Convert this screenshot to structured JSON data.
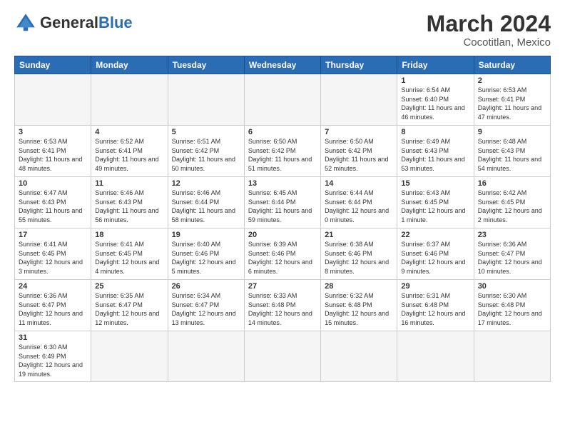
{
  "header": {
    "logo_general": "General",
    "logo_blue": "Blue",
    "month_title": "March 2024",
    "location": "Cocotitlan, Mexico"
  },
  "weekdays": [
    "Sunday",
    "Monday",
    "Tuesday",
    "Wednesday",
    "Thursday",
    "Friday",
    "Saturday"
  ],
  "weeks": [
    [
      {
        "day": "",
        "info": ""
      },
      {
        "day": "",
        "info": ""
      },
      {
        "day": "",
        "info": ""
      },
      {
        "day": "",
        "info": ""
      },
      {
        "day": "",
        "info": ""
      },
      {
        "day": "1",
        "info": "Sunrise: 6:54 AM\nSunset: 6:40 PM\nDaylight: 11 hours and 46 minutes."
      },
      {
        "day": "2",
        "info": "Sunrise: 6:53 AM\nSunset: 6:41 PM\nDaylight: 11 hours and 47 minutes."
      }
    ],
    [
      {
        "day": "3",
        "info": "Sunrise: 6:53 AM\nSunset: 6:41 PM\nDaylight: 11 hours and 48 minutes."
      },
      {
        "day": "4",
        "info": "Sunrise: 6:52 AM\nSunset: 6:41 PM\nDaylight: 11 hours and 49 minutes."
      },
      {
        "day": "5",
        "info": "Sunrise: 6:51 AM\nSunset: 6:42 PM\nDaylight: 11 hours and 50 minutes."
      },
      {
        "day": "6",
        "info": "Sunrise: 6:50 AM\nSunset: 6:42 PM\nDaylight: 11 hours and 51 minutes."
      },
      {
        "day": "7",
        "info": "Sunrise: 6:50 AM\nSunset: 6:42 PM\nDaylight: 11 hours and 52 minutes."
      },
      {
        "day": "8",
        "info": "Sunrise: 6:49 AM\nSunset: 6:43 PM\nDaylight: 11 hours and 53 minutes."
      },
      {
        "day": "9",
        "info": "Sunrise: 6:48 AM\nSunset: 6:43 PM\nDaylight: 11 hours and 54 minutes."
      }
    ],
    [
      {
        "day": "10",
        "info": "Sunrise: 6:47 AM\nSunset: 6:43 PM\nDaylight: 11 hours and 55 minutes."
      },
      {
        "day": "11",
        "info": "Sunrise: 6:46 AM\nSunset: 6:43 PM\nDaylight: 11 hours and 56 minutes."
      },
      {
        "day": "12",
        "info": "Sunrise: 6:46 AM\nSunset: 6:44 PM\nDaylight: 11 hours and 58 minutes."
      },
      {
        "day": "13",
        "info": "Sunrise: 6:45 AM\nSunset: 6:44 PM\nDaylight: 11 hours and 59 minutes."
      },
      {
        "day": "14",
        "info": "Sunrise: 6:44 AM\nSunset: 6:44 PM\nDaylight: 12 hours and 0 minutes."
      },
      {
        "day": "15",
        "info": "Sunrise: 6:43 AM\nSunset: 6:45 PM\nDaylight: 12 hours and 1 minute."
      },
      {
        "day": "16",
        "info": "Sunrise: 6:42 AM\nSunset: 6:45 PM\nDaylight: 12 hours and 2 minutes."
      }
    ],
    [
      {
        "day": "17",
        "info": "Sunrise: 6:41 AM\nSunset: 6:45 PM\nDaylight: 12 hours and 3 minutes."
      },
      {
        "day": "18",
        "info": "Sunrise: 6:41 AM\nSunset: 6:45 PM\nDaylight: 12 hours and 4 minutes."
      },
      {
        "day": "19",
        "info": "Sunrise: 6:40 AM\nSunset: 6:46 PM\nDaylight: 12 hours and 5 minutes."
      },
      {
        "day": "20",
        "info": "Sunrise: 6:39 AM\nSunset: 6:46 PM\nDaylight: 12 hours and 6 minutes."
      },
      {
        "day": "21",
        "info": "Sunrise: 6:38 AM\nSunset: 6:46 PM\nDaylight: 12 hours and 8 minutes."
      },
      {
        "day": "22",
        "info": "Sunrise: 6:37 AM\nSunset: 6:46 PM\nDaylight: 12 hours and 9 minutes."
      },
      {
        "day": "23",
        "info": "Sunrise: 6:36 AM\nSunset: 6:47 PM\nDaylight: 12 hours and 10 minutes."
      }
    ],
    [
      {
        "day": "24",
        "info": "Sunrise: 6:36 AM\nSunset: 6:47 PM\nDaylight: 12 hours and 11 minutes."
      },
      {
        "day": "25",
        "info": "Sunrise: 6:35 AM\nSunset: 6:47 PM\nDaylight: 12 hours and 12 minutes."
      },
      {
        "day": "26",
        "info": "Sunrise: 6:34 AM\nSunset: 6:47 PM\nDaylight: 12 hours and 13 minutes."
      },
      {
        "day": "27",
        "info": "Sunrise: 6:33 AM\nSunset: 6:48 PM\nDaylight: 12 hours and 14 minutes."
      },
      {
        "day": "28",
        "info": "Sunrise: 6:32 AM\nSunset: 6:48 PM\nDaylight: 12 hours and 15 minutes."
      },
      {
        "day": "29",
        "info": "Sunrise: 6:31 AM\nSunset: 6:48 PM\nDaylight: 12 hours and 16 minutes."
      },
      {
        "day": "30",
        "info": "Sunrise: 6:30 AM\nSunset: 6:48 PM\nDaylight: 12 hours and 17 minutes."
      }
    ],
    [
      {
        "day": "31",
        "info": "Sunrise: 6:30 AM\nSunset: 6:49 PM\nDaylight: 12 hours and 19 minutes."
      },
      {
        "day": "",
        "info": ""
      },
      {
        "day": "",
        "info": ""
      },
      {
        "day": "",
        "info": ""
      },
      {
        "day": "",
        "info": ""
      },
      {
        "day": "",
        "info": ""
      },
      {
        "day": "",
        "info": ""
      }
    ]
  ]
}
